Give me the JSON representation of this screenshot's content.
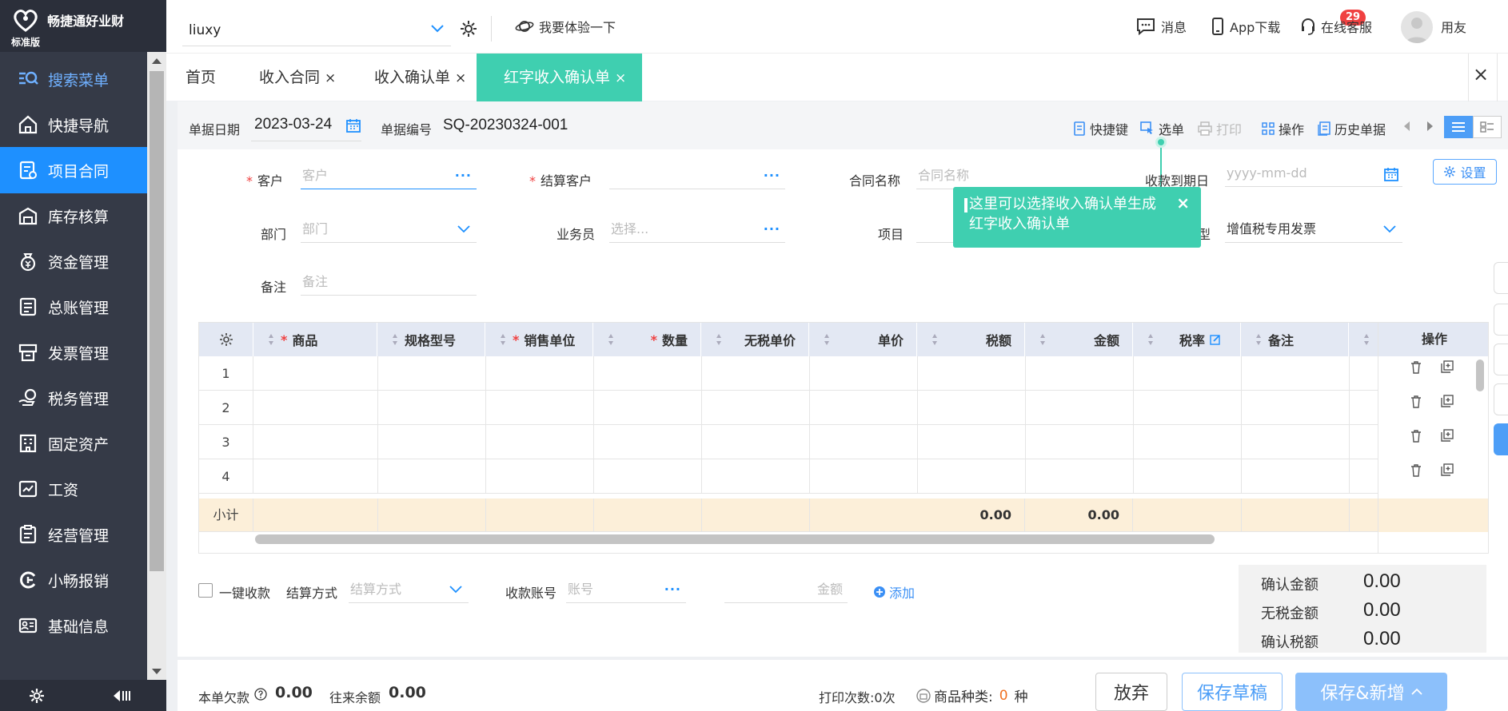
{
  "app": {
    "name": "畅捷通好业财",
    "edition": "标准版"
  },
  "sidebar": {
    "items": [
      {
        "label": "搜索菜单"
      },
      {
        "label": "快捷导航"
      },
      {
        "label": "项目合同"
      },
      {
        "label": "库存核算"
      },
      {
        "label": "资金管理"
      },
      {
        "label": "总账管理"
      },
      {
        "label": "发票管理"
      },
      {
        "label": "税务管理"
      },
      {
        "label": "固定资产"
      },
      {
        "label": "工资"
      },
      {
        "label": "经营管理"
      },
      {
        "label": "小畅报销"
      },
      {
        "label": "基础信息"
      }
    ],
    "active": "项目合同"
  },
  "topbar": {
    "company": "liuxy",
    "experience": "我要体验一下",
    "messages": "消息",
    "message_count": "29",
    "app_download": "App下载",
    "service": "在线客服",
    "user": "用友"
  },
  "tabs": [
    {
      "label": "首页"
    },
    {
      "label": "收入合同"
    },
    {
      "label": "收入确认单"
    },
    {
      "label": "红字收入确认单"
    }
  ],
  "active_tab": "红字收入确认单",
  "toolbar": {
    "date_label": "单据日期",
    "date_value": "2023-03-24",
    "number_label": "单据编号",
    "number_value": "SQ-20230324-001",
    "shortcut": "快捷键",
    "select": "选单",
    "print": "打印",
    "operate": "操作",
    "history": "历史单据"
  },
  "form": {
    "customer_label": "客户",
    "customer_placeholder": "客户",
    "settle_customer_label": "结算客户",
    "contract_label": "合同名称",
    "contract_placeholder": "合同名称",
    "due_label": "收款到期日",
    "due_placeholder": "yyyy-mm-dd",
    "settings": "设置",
    "dept_label": "部门",
    "dept_placeholder": "部门",
    "salesman_label": "业务员",
    "salesman_placeholder": "选择...",
    "project_label": "项目",
    "invoice_type_label": "型",
    "invoice_type_value": "增值税专用发票",
    "remark_label": "备注",
    "remark_placeholder": "备注"
  },
  "tooltip": {
    "text_line1": "这里可以选择收入确认单生成",
    "text_line2": "红字收入确认单"
  },
  "grid": {
    "columns": [
      "商品",
      "规格型号",
      "销售单位",
      "数量",
      "无税单价",
      "单价",
      "税额",
      "金额",
      "税率",
      "备注",
      "操作"
    ],
    "rows": [
      "1",
      "2",
      "3",
      "4"
    ],
    "subtotal_label": "小计",
    "subtotal_tax": "0.00",
    "subtotal_amount": "0.00"
  },
  "receipt": {
    "one_click": "一键收款",
    "method_label": "结算方式",
    "method_placeholder": "结算方式",
    "account_label": "收款账号",
    "account_placeholder": "账号",
    "amount_placeholder": "金额",
    "add": "添加"
  },
  "summary": {
    "confirm_amount_label": "确认金额",
    "confirm_amount": "0.00",
    "notax_amount_label": "无税金额",
    "notax_amount": "0.00",
    "confirm_tax_label": "确认税额",
    "confirm_tax": "0.00"
  },
  "footer": {
    "debt_label": "本单欠款",
    "debt_value": "0.00",
    "balance_label": "往来余额",
    "balance_value": "0.00",
    "print_count": "打印次数:0次",
    "goods_types_label": "商品种类:",
    "goods_types_count": "0",
    "goods_types_unit": "种",
    "discard": "放弃",
    "save_draft": "保存草稿",
    "save_new": "保存&新增"
  },
  "colors": {
    "primary": "#1e90ff",
    "accent": "#3fcfb0",
    "sidebar": "#353a47",
    "danger": "#f04040"
  }
}
